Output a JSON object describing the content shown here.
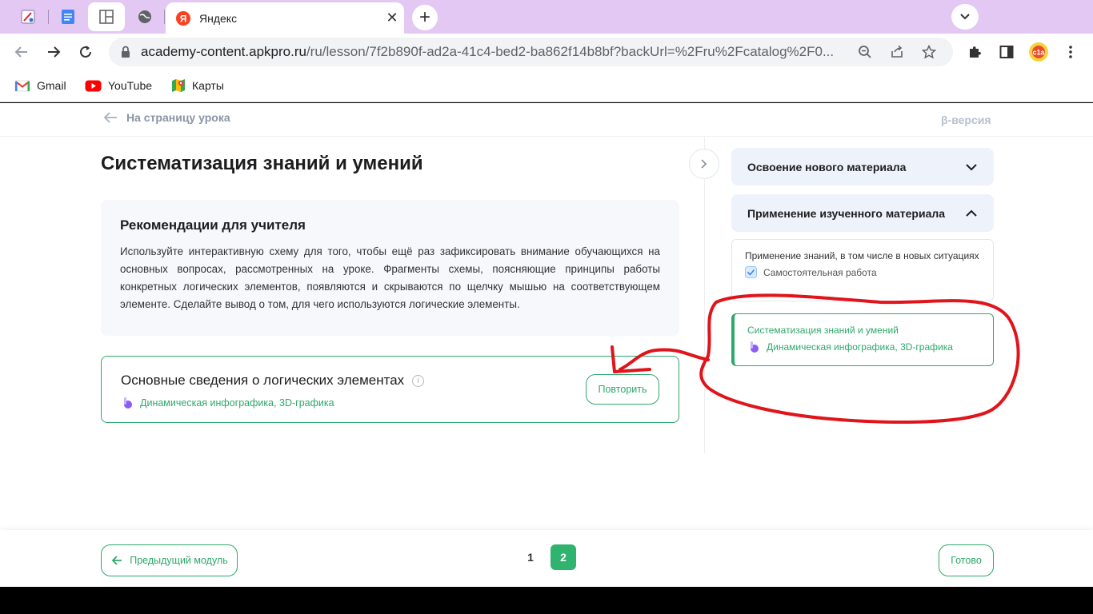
{
  "browser": {
    "active_tab_title": "Яндекс",
    "new_tab_symbol": "+",
    "close_symbol": "✕",
    "url_host": "academy-content.apkpro.ru",
    "url_path": "/ru/lesson/7f2b890f-ad2a-41c4-bed2-ba862f14b8bf?backUrl=%2Fru%2Fcatalog%2F0...",
    "bookmarks": [
      {
        "label": "Gmail",
        "icon": "gmail-icon"
      },
      {
        "label": "YouTube",
        "icon": "youtube-icon"
      },
      {
        "label": "Карты",
        "icon": "maps-icon"
      }
    ],
    "profile_badge": "c1a"
  },
  "page": {
    "back_label": "На страницу урока",
    "beta_label": "β-версия",
    "title": "Систематизация знаний и умений",
    "recommendations": {
      "title": "Рекомендации для учителя",
      "text": "Используйте интерактивную схему для того, чтобы ещё раз зафиксировать внимание обучающихся на основных вопросах, рассмотренных на уроке. Фрагменты схемы, поясняющие принципы работы конкретных логических элементов, появляются и скрываются по щелчку мышью на соответствующем элементе. Сделайте вывод о том, для чего используются логические элементы."
    },
    "resource": {
      "title": "Основные сведения о логических элементах",
      "type": "Динамическая инфографика, 3D-графика",
      "repeat_label": "Повторить",
      "info_symbol": "i"
    }
  },
  "sidebar": {
    "sections": [
      {
        "label": "Освоение нового материала",
        "expanded": false
      },
      {
        "label": "Применение изученного материала",
        "expanded": true
      }
    ],
    "items": [
      {
        "title": "Применение знаний, в том числе в новых ситуациях",
        "type": "Самостоятельная работа",
        "icon": "checkbox-icon",
        "active": false
      },
      {
        "title": "Систематизация знаний и умений",
        "type": "Динамическая инфографика, 3D-графика",
        "icon": "hand-pointer-icon",
        "active": true
      }
    ]
  },
  "footer": {
    "prev_label": "Предыдущий модуль",
    "pages": [
      "1",
      "2"
    ],
    "current_page": "2",
    "done_label": "Готово"
  },
  "colors": {
    "accent_green": "#2ea86b",
    "tab_bar": "#e3c8f3",
    "annotation_red": "#e0141b"
  }
}
